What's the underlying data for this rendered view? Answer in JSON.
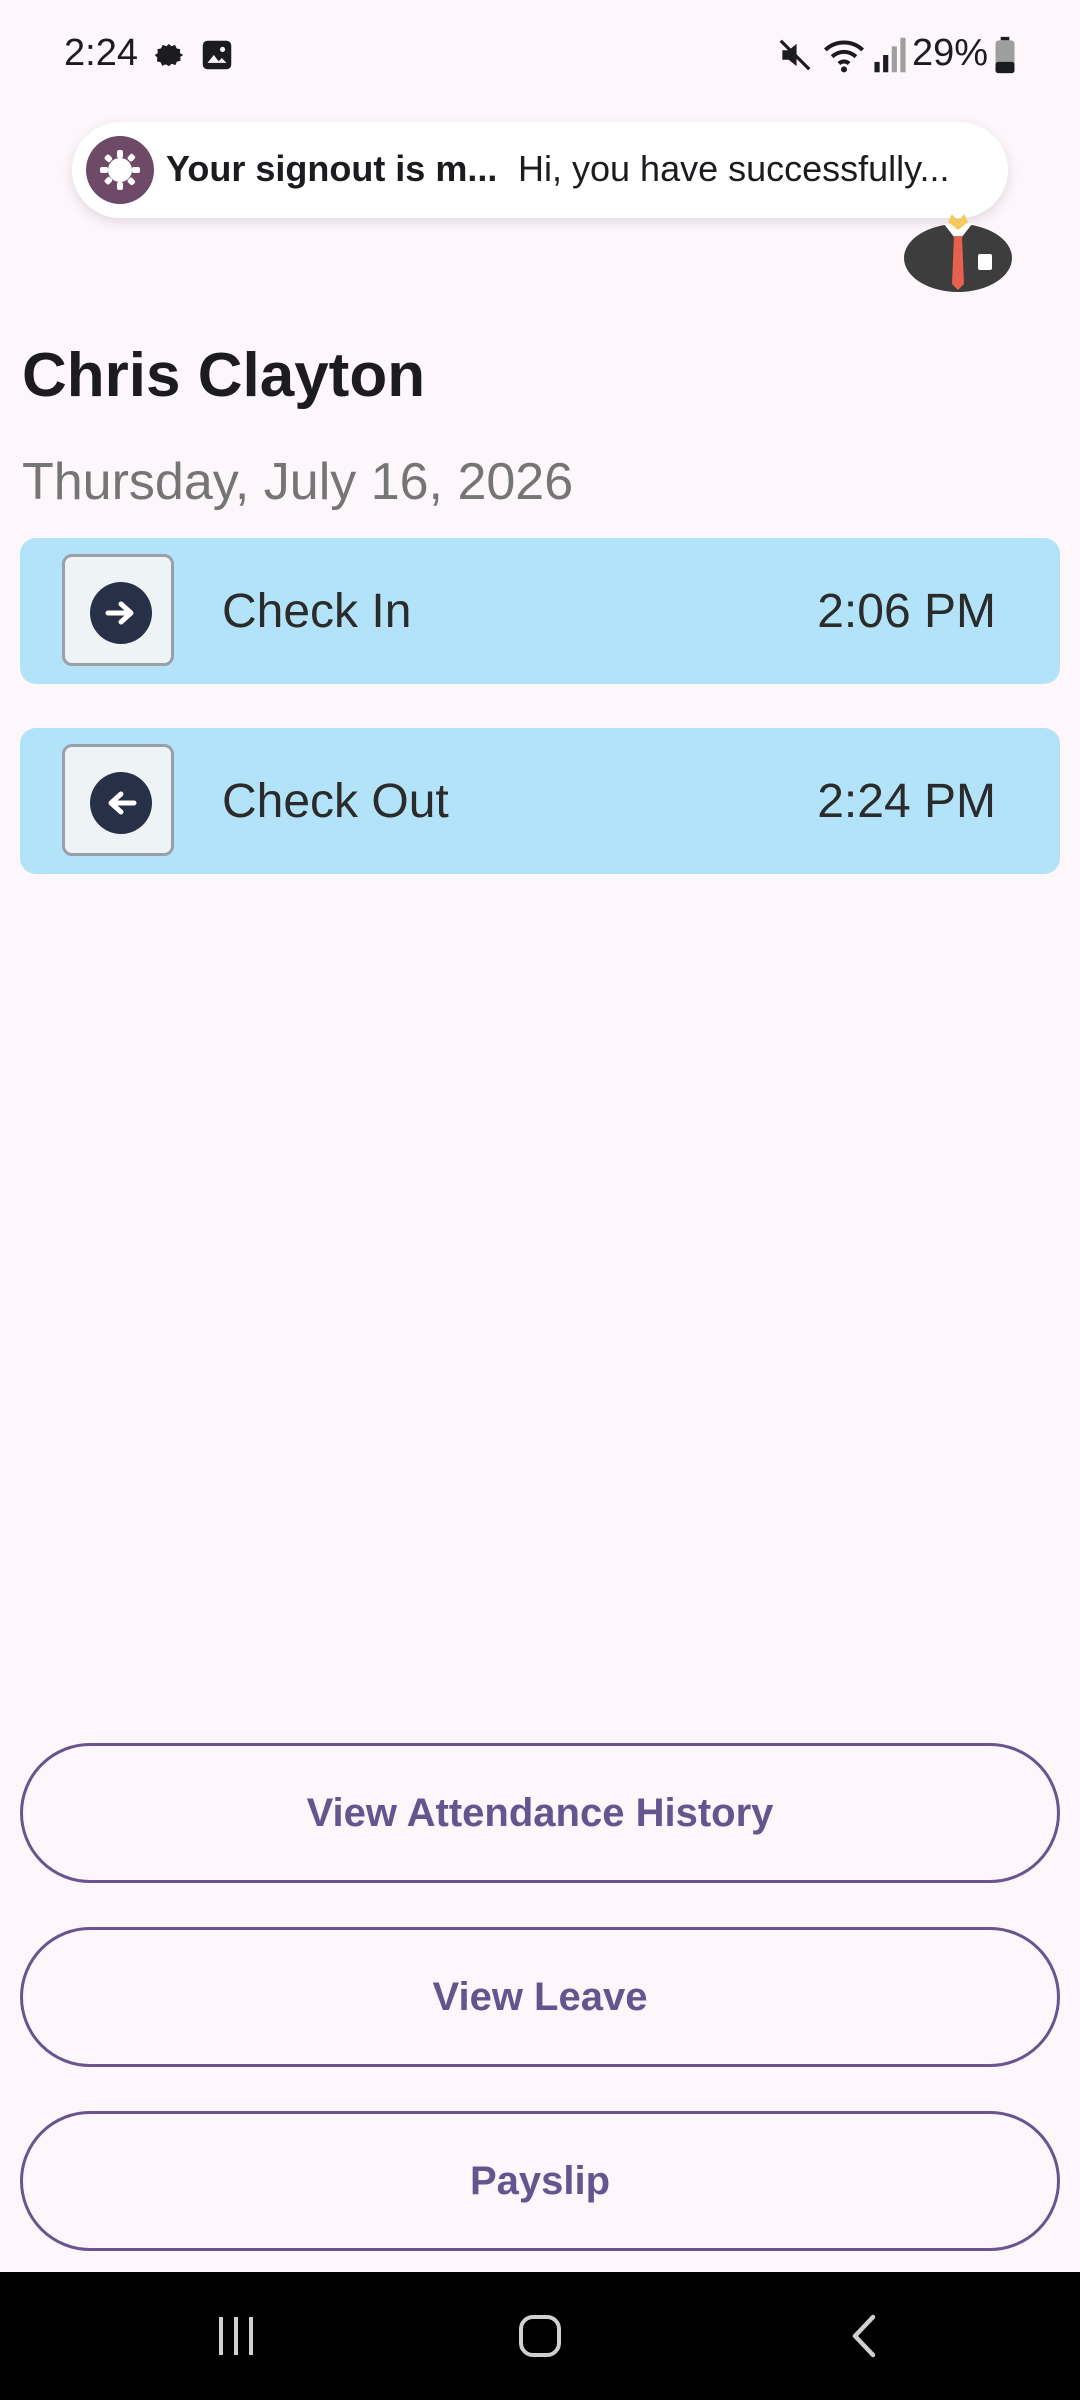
{
  "status_bar": {
    "time": "2:24",
    "battery": "29%",
    "icons": [
      "settings-icon",
      "image-icon",
      "mute-icon",
      "wifi-icon",
      "signal-icon",
      "battery-icon"
    ]
  },
  "notification": {
    "title": "Your signout is m...",
    "body": "Hi, you have successfully...",
    "icon": "settings-icon"
  },
  "profile": {
    "name": "Chris Clayton",
    "date": "Thursday, July 16, 2026"
  },
  "attendance": [
    {
      "label": "Check In",
      "time": "2:06 PM",
      "icon": "arrow-right-icon"
    },
    {
      "label": "Check Out",
      "time": "2:24 PM",
      "icon": "arrow-left-icon"
    }
  ],
  "actions": {
    "history": "View Attendance History",
    "leave": "View Leave",
    "payslip": "Payslip"
  },
  "colors": {
    "background": "#fdf6fb",
    "card": "#b3e3f9",
    "accent": "#65558f"
  },
  "nav": [
    "recent-apps-icon",
    "home-icon",
    "back-icon"
  ]
}
